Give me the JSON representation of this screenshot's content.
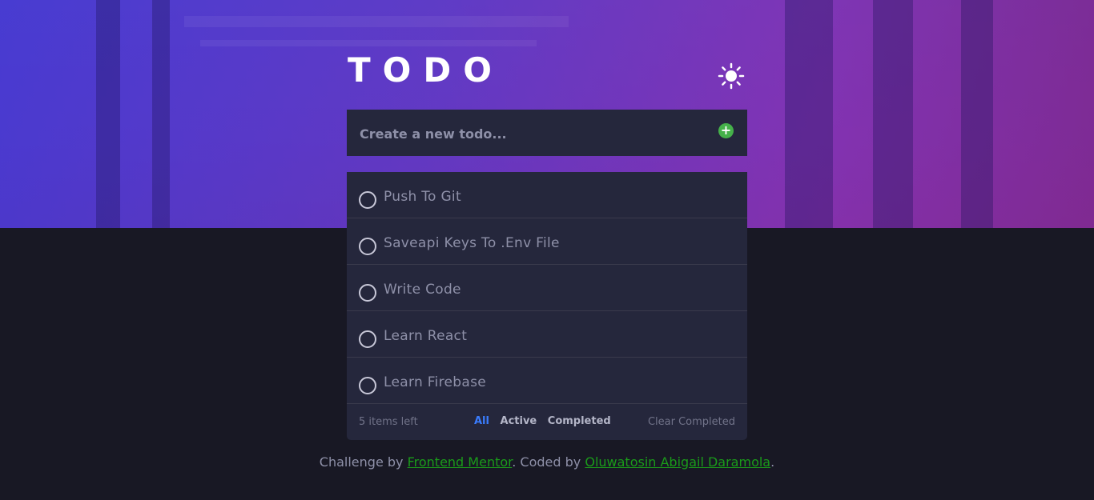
{
  "header": {
    "title": "TODO",
    "theme_icon": "sun-icon"
  },
  "new_todo": {
    "placeholder": "Create a new todo...",
    "add_icon": "plus-circle-icon",
    "add_color": "#45b14a"
  },
  "todos": [
    {
      "text": "Push To Git",
      "completed": false
    },
    {
      "text": "Saveapi Keys To .Env File",
      "completed": false
    },
    {
      "text": "Write Code",
      "completed": false
    },
    {
      "text": "Learn React",
      "completed": false
    },
    {
      "text": "Learn Firebase",
      "completed": false
    }
  ],
  "footer": {
    "items_left": "5 items left",
    "filters": [
      "All",
      "Active",
      "Completed"
    ],
    "active_filter": "All",
    "clear_label": "Clear Completed",
    "accent_color": "#3a7cfd"
  },
  "attribution": {
    "prefix": "Challenge by ",
    "link1": "Frontend Mentor",
    "middle": ". Coded by ",
    "link2": "Oluwatosin Abigail Daramola",
    "suffix": "."
  }
}
